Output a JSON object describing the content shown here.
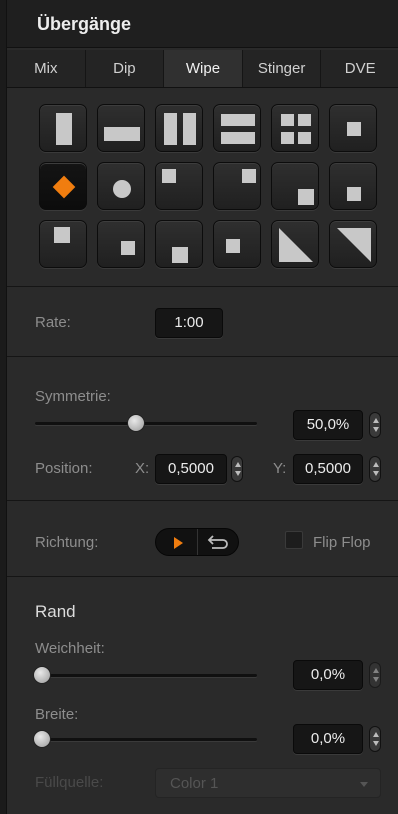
{
  "panel": {
    "title": "Übergänge"
  },
  "tabs": [
    {
      "label": "Mix"
    },
    {
      "label": "Dip"
    },
    {
      "label": "Wipe",
      "active": true
    },
    {
      "label": "Stinger"
    },
    {
      "label": "DVE"
    }
  ],
  "patterns": [
    "vertical-bar",
    "horizontal-bar",
    "vertical-split",
    "horizontal-split",
    "four-box",
    "center-box",
    "diamond",
    "circle",
    "top-left-box",
    "top-right-box",
    "bottom-right-box",
    "right-box",
    "left-box-top",
    "center-box-low",
    "bottom-center-box",
    "center-right-box",
    "diagonal-left",
    "diagonal-right"
  ],
  "selected_pattern": "diamond",
  "accent_color": "#f07d0f",
  "rate": {
    "label": "Rate:",
    "value": "1:00"
  },
  "symmetry": {
    "label": "Symmetrie:",
    "value": "50,0%",
    "level": 0.5
  },
  "position": {
    "label": "Position:",
    "x_label": "X:",
    "x_value": "0,5000",
    "y_label": "Y:",
    "y_value": "0,5000"
  },
  "direction": {
    "label": "Richtung:",
    "flipflop_label": "Flip Flop",
    "flipflop_checked": false
  },
  "border": {
    "heading": "Rand",
    "softness_label": "Weichheit:",
    "softness_value": "0,0%",
    "softness_level": 0,
    "width_label": "Breite:",
    "width_value": "0,0%",
    "width_level": 0
  },
  "fill_source": {
    "label": "Füllquelle:",
    "value": "Color 1"
  }
}
